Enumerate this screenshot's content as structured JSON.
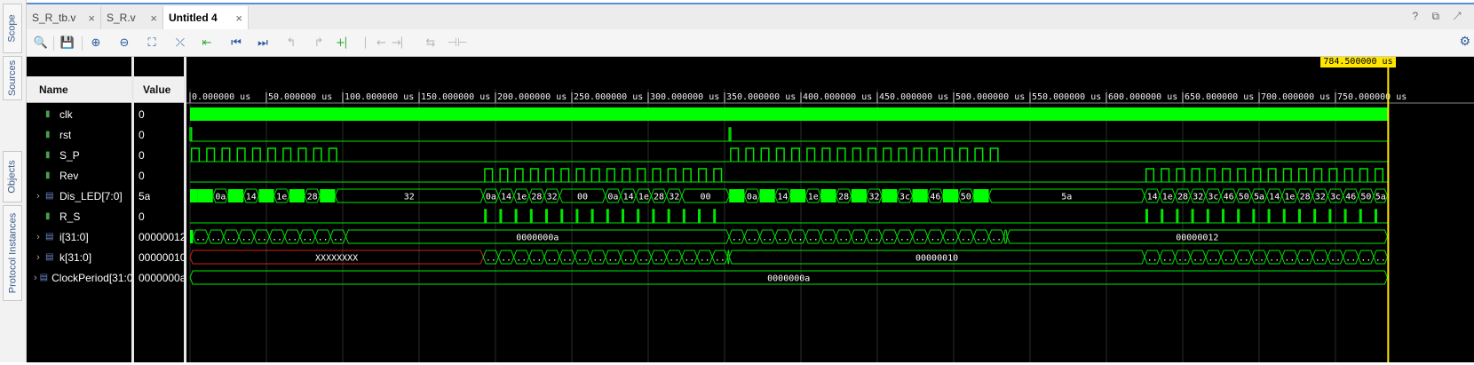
{
  "side_tabs": [
    "Scope",
    "Sources",
    "Objects",
    "Protocol Instances"
  ],
  "tabs": [
    {
      "label": "S_R_tb.v",
      "active": false
    },
    {
      "label": "S_R.v",
      "active": false
    },
    {
      "label": "Untitled 4",
      "active": true
    }
  ],
  "tab_close": "×",
  "tabbar_right_icons": "? ⧉ ↗",
  "toolbar": [
    {
      "icon": "search-icon",
      "glyph": "🔍"
    },
    {
      "icon": "save-icon",
      "glyph": "💾"
    },
    {
      "icon": "zoom-in-icon",
      "glyph": "⊕"
    },
    {
      "icon": "zoom-out-icon",
      "glyph": "⊖"
    },
    {
      "icon": "zoom-fit-icon",
      "glyph": "⛶"
    },
    {
      "icon": "go-to-cursor-icon",
      "glyph": "⤫"
    },
    {
      "icon": "previous-marker-icon",
      "glyph": "⇤"
    },
    {
      "icon": "go-to-start-icon",
      "glyph": "⏮"
    },
    {
      "icon": "go-to-end-icon",
      "glyph": "⏭"
    },
    {
      "icon": "previous-transition-icon",
      "glyph": "↰"
    },
    {
      "icon": "next-transition-icon",
      "glyph": "↱"
    },
    {
      "icon": "add-marker-icon",
      "glyph": "+⎸"
    },
    {
      "icon": "previous-marker-nav-icon",
      "glyph": "⎸←"
    },
    {
      "icon": "next-marker-nav-icon",
      "glyph": "→⎸"
    },
    {
      "icon": "swap-cursors-icon",
      "glyph": "⇆"
    },
    {
      "icon": "snap-icon",
      "glyph": "⊣⊢"
    }
  ],
  "settings_icon": "⚙",
  "columns": {
    "name": "Name",
    "value": "Value"
  },
  "signals": [
    {
      "name": "clk",
      "value": "0",
      "kind": "bit",
      "expandable": false
    },
    {
      "name": "rst",
      "value": "0",
      "kind": "bit",
      "expandable": false
    },
    {
      "name": "S_P",
      "value": "0",
      "kind": "bit",
      "expandable": false
    },
    {
      "name": "Rev",
      "value": "0",
      "kind": "bit",
      "expandable": false
    },
    {
      "name": "Dis_LED[7:0]",
      "value": "5a",
      "kind": "bus",
      "expandable": true
    },
    {
      "name": "R_S",
      "value": "0",
      "kind": "bit",
      "expandable": false
    },
    {
      "name": "i[31:0]",
      "value": "00000012",
      "kind": "bus",
      "expandable": true
    },
    {
      "name": "k[31:0]",
      "value": "00000010",
      "kind": "bus",
      "expandable": true
    },
    {
      "name": "ClockPeriod[31:0]",
      "value": "0000000a",
      "kind": "bus",
      "expandable": true
    }
  ],
  "time_axis": {
    "unit": "us",
    "ticks": [
      "0.000000 us",
      "50.000000 us",
      "100.000000 us",
      "150.000000 us",
      "200.000000 us",
      "250.000000 us",
      "300.000000 us",
      "350.000000 us",
      "400.000000 us",
      "450.000000 us",
      "500.000000 us",
      "550.000000 us",
      "600.000000 us",
      "650.000000 us",
      "700.000000 us",
      "750.000000 us"
    ],
    "cursor": "784.500000 us"
  },
  "waves": {
    "rst_pulses_us": [
      0,
      353
    ],
    "sp_start_us": [
      0,
      353
    ],
    "sp_end_us": [
      97,
      530
    ],
    "rev_start_us": [
      192,
      625
    ],
    "rev_end_us": [
      353,
      784
    ],
    "dis_led_segments": [
      {
        "t0": 0,
        "t1": 5,
        "label": "",
        "fill": true
      },
      {
        "t0": 5,
        "t1": 15,
        "label": "",
        "fill": true
      },
      {
        "t0": 15,
        "t1": 25,
        "label": "0a",
        "fill": false
      },
      {
        "t0": 25,
        "t1": 35,
        "label": "",
        "fill": true
      },
      {
        "t0": 35,
        "t1": 45,
        "label": "14",
        "fill": false
      },
      {
        "t0": 45,
        "t1": 55,
        "label": "",
        "fill": true
      },
      {
        "t0": 55,
        "t1": 65,
        "label": "1e",
        "fill": false
      },
      {
        "t0": 65,
        "t1": 75,
        "label": "",
        "fill": true
      },
      {
        "t0": 75,
        "t1": 85,
        "label": "28",
        "fill": false
      },
      {
        "t0": 85,
        "t1": 95,
        "label": "",
        "fill": true
      },
      {
        "t0": 95,
        "t1": 192,
        "label": "32",
        "fill": false
      },
      {
        "t0": 192,
        "t1": 202,
        "label": "0a",
        "fill": false
      },
      {
        "t0": 202,
        "t1": 212,
        "label": "14",
        "fill": false
      },
      {
        "t0": 212,
        "t1": 222,
        "label": "1e",
        "fill": false
      },
      {
        "t0": 222,
        "t1": 232,
        "label": "28",
        "fill": false
      },
      {
        "t0": 232,
        "t1": 242,
        "label": "32",
        "fill": false
      },
      {
        "t0": 242,
        "t1": 272,
        "label": "00",
        "fill": false
      },
      {
        "t0": 272,
        "t1": 282,
        "label": "0a",
        "fill": false
      },
      {
        "t0": 282,
        "t1": 292,
        "label": "14",
        "fill": false
      },
      {
        "t0": 292,
        "t1": 302,
        "label": "1e",
        "fill": false
      },
      {
        "t0": 302,
        "t1": 312,
        "label": "28",
        "fill": false
      },
      {
        "t0": 312,
        "t1": 322,
        "label": "32",
        "fill": false
      },
      {
        "t0": 322,
        "t1": 353,
        "label": "00",
        "fill": false
      },
      {
        "t0": 353,
        "t1": 363,
        "label": "",
        "fill": true
      },
      {
        "t0": 363,
        "t1": 373,
        "label": "0a",
        "fill": false
      },
      {
        "t0": 373,
        "t1": 383,
        "label": "",
        "fill": true
      },
      {
        "t0": 383,
        "t1": 393,
        "label": "14",
        "fill": false
      },
      {
        "t0": 393,
        "t1": 403,
        "label": "",
        "fill": true
      },
      {
        "t0": 403,
        "t1": 413,
        "label": "1e",
        "fill": false
      },
      {
        "t0": 413,
        "t1": 423,
        "label": "",
        "fill": true
      },
      {
        "t0": 423,
        "t1": 433,
        "label": "28",
        "fill": false
      },
      {
        "t0": 433,
        "t1": 443,
        "label": "",
        "fill": true
      },
      {
        "t0": 443,
        "t1": 453,
        "label": "32",
        "fill": false
      },
      {
        "t0": 453,
        "t1": 463,
        "label": "",
        "fill": true
      },
      {
        "t0": 463,
        "t1": 473,
        "label": "3c",
        "fill": false
      },
      {
        "t0": 473,
        "t1": 483,
        "label": "",
        "fill": true
      },
      {
        "t0": 483,
        "t1": 493,
        "label": "46",
        "fill": false
      },
      {
        "t0": 493,
        "t1": 503,
        "label": "",
        "fill": true
      },
      {
        "t0": 503,
        "t1": 513,
        "label": "50",
        "fill": false
      },
      {
        "t0": 513,
        "t1": 523,
        "label": "",
        "fill": true
      },
      {
        "t0": 523,
        "t1": 625,
        "label": "5a",
        "fill": false
      },
      {
        "t0": 625,
        "t1": 635,
        "label": "14",
        "fill": false
      },
      {
        "t0": 635,
        "t1": 645,
        "label": "1e",
        "fill": false
      },
      {
        "t0": 645,
        "t1": 655,
        "label": "28",
        "fill": false
      },
      {
        "t0": 655,
        "t1": 665,
        "label": "32",
        "fill": false
      },
      {
        "t0": 665,
        "t1": 675,
        "label": "3c",
        "fill": false
      },
      {
        "t0": 675,
        "t1": 685,
        "label": "46",
        "fill": false
      },
      {
        "t0": 685,
        "t1": 695,
        "label": "50",
        "fill": false
      },
      {
        "t0": 695,
        "t1": 705,
        "label": "5a",
        "fill": false
      },
      {
        "t0": 705,
        "t1": 715,
        "label": "14",
        "fill": false
      },
      {
        "t0": 715,
        "t1": 725,
        "label": "1e",
        "fill": false
      },
      {
        "t0": 725,
        "t1": 735,
        "label": "28",
        "fill": false
      },
      {
        "t0": 735,
        "t1": 745,
        "label": "32",
        "fill": false
      },
      {
        "t0": 745,
        "t1": 755,
        "label": "3c",
        "fill": false
      },
      {
        "t0": 755,
        "t1": 765,
        "label": "46",
        "fill": false
      },
      {
        "t0": 765,
        "t1": 775,
        "label": "50",
        "fill": false
      },
      {
        "t0": 775,
        "t1": 784,
        "label": "5a",
        "fill": false
      }
    ],
    "i_segments": [
      {
        "t0": 0,
        "t1": 2,
        "label": "",
        "fill": true
      },
      {
        "t0": 2,
        "t1": 102,
        "label": "..",
        "step": 10
      },
      {
        "t0": 102,
        "t1": 353,
        "label": "0000000a"
      },
      {
        "t0": 353,
        "t1": 535,
        "label": "..",
        "step": 10
      },
      {
        "t0": 535,
        "t1": 784,
        "label": "00000012"
      }
    ],
    "k_segments": [
      {
        "t0": 0,
        "t1": 192,
        "label": "XXXXXXXX",
        "undefined": true
      },
      {
        "t0": 192,
        "t1": 353,
        "label": "..",
        "step": 10
      },
      {
        "t0": 353,
        "t1": 625,
        "label": "00000010"
      },
      {
        "t0": 625,
        "t1": 784,
        "label": "..",
        "step": 10
      }
    ],
    "clock_period_segments": [
      {
        "t0": 0,
        "t1": 784,
        "label": "0000000a"
      }
    ],
    "colors": {
      "signal": "#00e600",
      "fill": "#00ff00",
      "undefined": "#d02020",
      "text": "#ffffff",
      "cursor": "#ffe600",
      "grid": "#2d2d2d"
    }
  }
}
